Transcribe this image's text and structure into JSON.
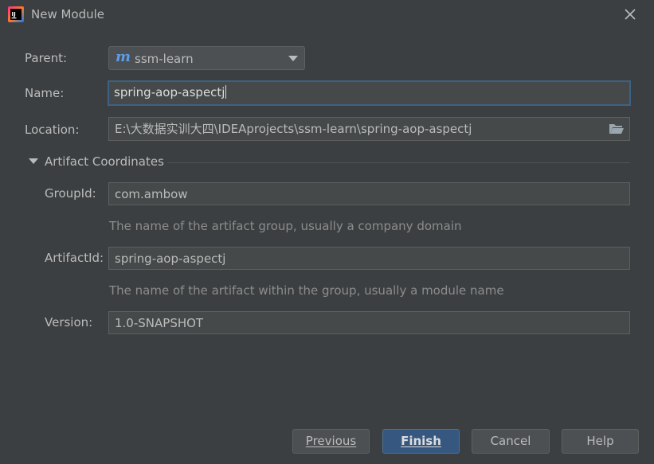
{
  "window": {
    "title": "New Module",
    "app_icon": "intellij-idea-icon",
    "close_icon": "close-icon"
  },
  "form": {
    "parent": {
      "label": "Parent:",
      "value": "ssm-learn",
      "icon": "maven-m-icon"
    },
    "name": {
      "label": "Name:",
      "value": "spring-aop-aspectj"
    },
    "location": {
      "label": "Location:",
      "value": "E:\\大数据实训大四\\IDEAprojects\\ssm-learn\\spring-aop-aspectj",
      "browse_icon": "folder-open-icon"
    }
  },
  "artifact": {
    "section_title": "Artifact Coordinates",
    "group_id": {
      "label": "GroupId:",
      "value": "com.ambow",
      "hint": "The name of the artifact group, usually a company domain"
    },
    "artifact_id": {
      "label": "ArtifactId:",
      "value": "spring-aop-aspectj",
      "hint": "The name of the artifact within the group, usually a module name"
    },
    "version": {
      "label": "Version:",
      "value": "1.0-SNAPSHOT"
    }
  },
  "buttons": {
    "previous": "Previous",
    "finish": "Finish",
    "cancel": "Cancel",
    "help": "Help"
  },
  "colors": {
    "background": "#3c3f41",
    "focus_border": "#3d6185",
    "primary_button": "#365880",
    "maven_blue": "#5d9ce8"
  }
}
